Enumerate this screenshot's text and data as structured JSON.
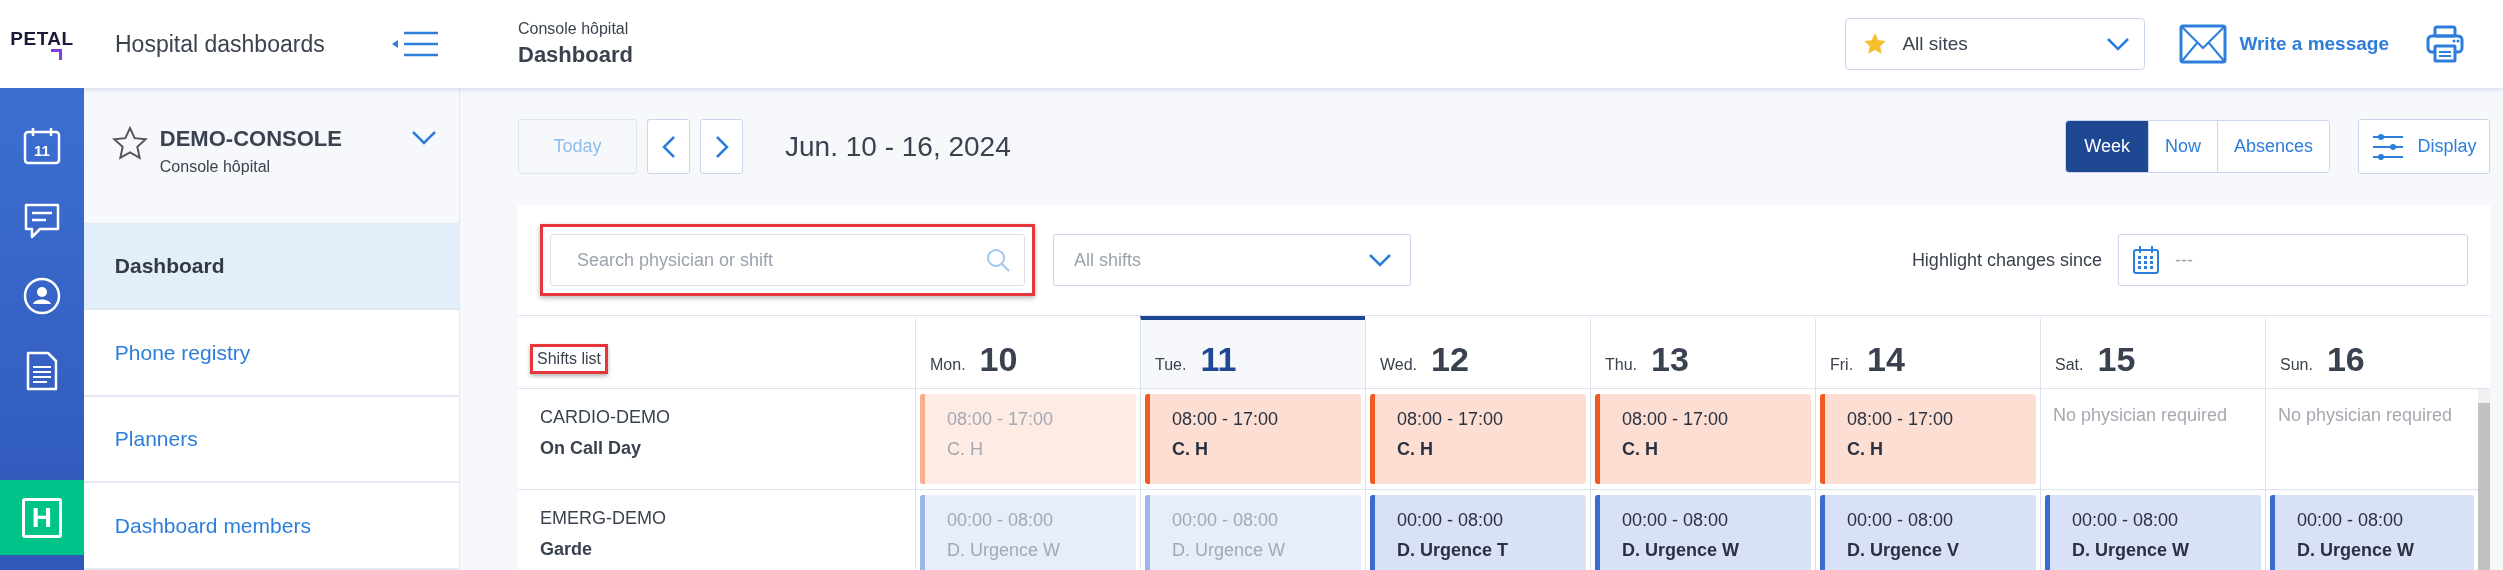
{
  "header": {
    "logo": "PETAL",
    "title": "Hospital dashboards",
    "breadcrumb": "Console hôpital",
    "page_title": "Dashboard",
    "site_select": {
      "value": "All sites"
    },
    "message_link": "Write a message"
  },
  "rail": [
    {
      "kind": "calendar",
      "label": "11",
      "selected": false
    },
    {
      "kind": "chat",
      "selected": false
    },
    {
      "kind": "user",
      "selected": false
    },
    {
      "kind": "document",
      "selected": false
    },
    {
      "kind": "hospital",
      "label": "H",
      "selected": true
    }
  ],
  "console": {
    "name": "DEMO-CONSOLE",
    "subtitle": "Console hôpital",
    "favorite": false
  },
  "nav": [
    {
      "label": "Dashboard",
      "selected": true
    },
    {
      "label": "Phone registry",
      "selected": false
    },
    {
      "label": "Planners",
      "selected": false
    },
    {
      "label": "Dashboard members",
      "selected": false
    }
  ],
  "toolbar": {
    "today": {
      "label": "Today",
      "disabled": true
    },
    "range": "Jun. 10 - 16, 2024",
    "views": [
      {
        "label": "Week",
        "selected": true
      },
      {
        "label": "Now",
        "selected": false
      },
      {
        "label": "Absences",
        "selected": false
      }
    ],
    "display": "Display"
  },
  "filters": {
    "search": {
      "placeholder": "Search physician or shift",
      "annotated": true
    },
    "shift_select": {
      "placeholder": "All shifts"
    },
    "highlight_label": "Highlight changes since",
    "highlight_date": {
      "placeholder": "---"
    }
  },
  "grid": {
    "first_column": {
      "label": "Shifts list",
      "annotated": true
    },
    "days": [
      {
        "weekday": "Mon.",
        "day": "10",
        "selected": false
      },
      {
        "weekday": "Tue.",
        "day": "11",
        "selected": true
      },
      {
        "weekday": "Wed.",
        "day": "12",
        "selected": false
      },
      {
        "weekday": "Thu.",
        "day": "13",
        "selected": false
      },
      {
        "weekday": "Fri.",
        "day": "14",
        "selected": false
      },
      {
        "weekday": "Sat.",
        "day": "15",
        "selected": false
      },
      {
        "weekday": "Sun.",
        "day": "16",
        "selected": false
      }
    ],
    "rows": [
      {
        "service": "CARDIO-DEMO",
        "shift": "On Call Day",
        "color": "#f15a22",
        "cells": [
          {
            "kind": "shift",
            "time": "08:00 - 17:00",
            "physician": "C. H",
            "past": true
          },
          {
            "kind": "shift",
            "time": "08:00 - 17:00",
            "physician": "C. H",
            "past": false
          },
          {
            "kind": "shift",
            "time": "08:00 - 17:00",
            "physician": "C. H",
            "past": false
          },
          {
            "kind": "shift",
            "time": "08:00 - 17:00",
            "physician": "C. H",
            "past": false
          },
          {
            "kind": "shift",
            "time": "08:00 - 17:00",
            "physician": "C. H",
            "past": false
          },
          {
            "kind": "none",
            "note": "No physician required"
          },
          {
            "kind": "none",
            "note": "No physician required"
          }
        ]
      },
      {
        "service": "EMERG-DEMO",
        "shift": "Garde",
        "color": "#3a6bd0",
        "cells": [
          {
            "kind": "shift",
            "time": "00:00 - 08:00",
            "physician": "D. Urgence W",
            "past": true
          },
          {
            "kind": "shift",
            "time": "00:00 - 08:00",
            "physician": "D. Urgence W",
            "past": true
          },
          {
            "kind": "shift",
            "time": "00:00 - 08:00",
            "physician": "D. Urgence T",
            "past": false
          },
          {
            "kind": "shift",
            "time": "00:00 - 08:00",
            "physician": "D. Urgence W",
            "past": false
          },
          {
            "kind": "shift",
            "time": "00:00 - 08:00",
            "physician": "D. Urgence V",
            "past": false
          },
          {
            "kind": "shift",
            "time": "00:00 - 08:00",
            "physician": "D. Urgence W",
            "past": false
          },
          {
            "kind": "shift",
            "time": "00:00 - 08:00",
            "physician": "D. Urgence W",
            "past": false
          }
        ]
      }
    ]
  }
}
